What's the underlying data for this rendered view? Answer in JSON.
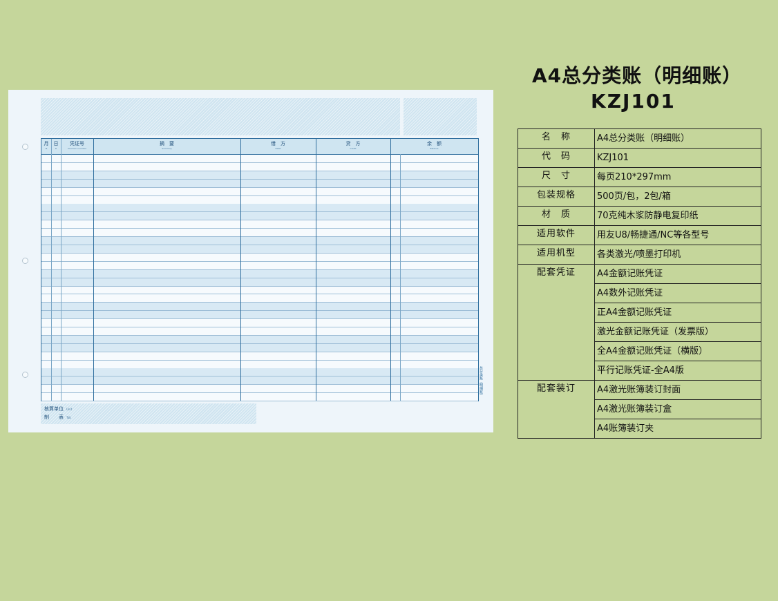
{
  "ledger": {
    "columns": [
      {
        "zh": "月",
        "en": "M"
      },
      {
        "zh": "日",
        "en": "D"
      },
      {
        "zh": "凭证号",
        "en": "Voucher's number"
      },
      {
        "zh": "摘　要",
        "en": "Summary"
      },
      {
        "zh": "借　方",
        "en": "Debit"
      },
      {
        "zh": "贷　方",
        "en": "Credit"
      },
      {
        "zh": "余　额",
        "en": "Balance"
      }
    ],
    "side_note": "总分类账（明细账）",
    "footer": {
      "unit_label": "核算单位",
      "unit_en": "Unit",
      "maker_label": "制　　表",
      "maker_en": "Tab"
    }
  },
  "product": {
    "title": "A4总分类账（明细账）",
    "code": "KZJ101"
  },
  "specs": [
    {
      "label": "名　称",
      "value": "A4总分类账（明细账）"
    },
    {
      "label": "代　码",
      "value": "KZJ101"
    },
    {
      "label": "尺　寸",
      "value": "每页210*297mm"
    },
    {
      "label": "包装规格",
      "value": "500页/包，2包/箱"
    },
    {
      "label": "材　质",
      "value": "70克纯木浆防静电复印纸"
    },
    {
      "label": "适用软件",
      "value": "用友U8/畅捷通/NC等各型号"
    },
    {
      "label": "适用机型",
      "value": "各类激光/喷墨打印机"
    }
  ],
  "vouchers": {
    "label": "配套凭证",
    "items": [
      "A4金额记账凭证",
      "A4数外记账凭证",
      "正A4金额记账凭证",
      "激光金额记账凭证（发票版）",
      "全A4金额记账凭证（横版）",
      "平行记账凭证-全A4版"
    ]
  },
  "binding": {
    "label": "配套装订",
    "items": [
      "A4激光账簿装订封面",
      "A4激光账簿装订盒",
      "A4账簿装订夹"
    ]
  }
}
